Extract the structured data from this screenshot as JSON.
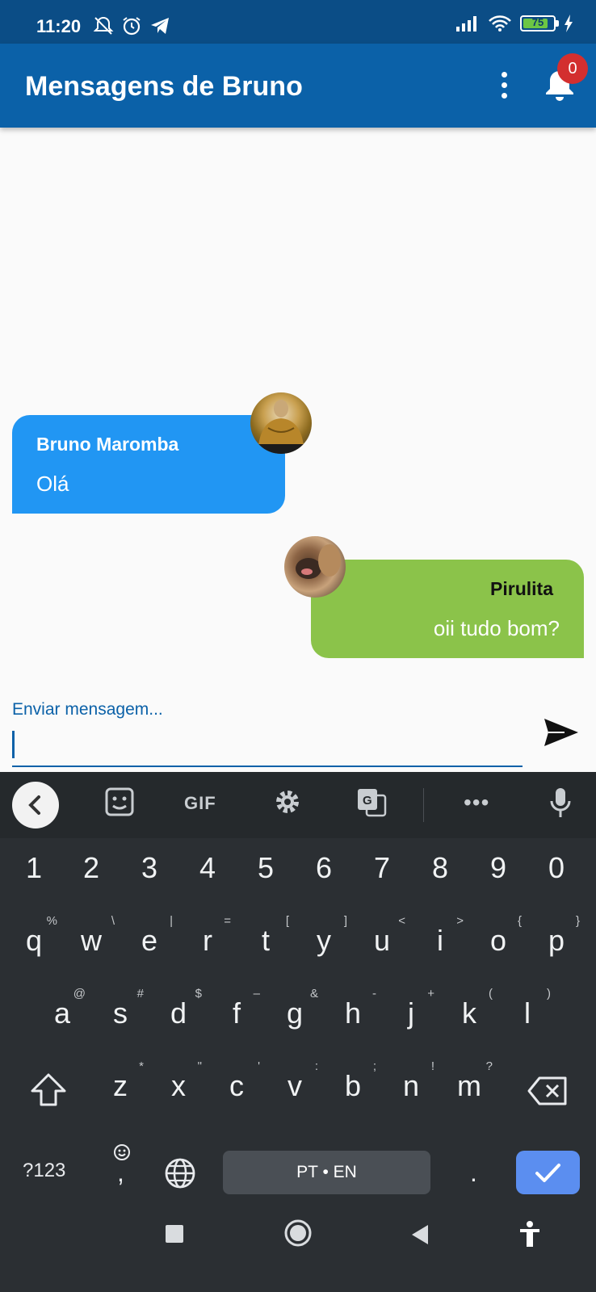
{
  "status_bar": {
    "time": "11:20",
    "battery": "75",
    "icons": [
      "bell-off-icon",
      "alarm-icon",
      "telegram-icon",
      "signal-icon",
      "wifi-icon",
      "battery-icon",
      "charging-icon"
    ]
  },
  "app_bar": {
    "title": "Mensagens de Bruno",
    "notification_count": "0"
  },
  "messages": [
    {
      "sender": "Bruno Maromba",
      "text": "Olá",
      "side": "left",
      "color": "#2196f3"
    },
    {
      "sender": "Pirulita",
      "text": "oii tudo bom?",
      "side": "right",
      "color": "#8bc34a"
    }
  ],
  "composer": {
    "label": "Enviar mensagem...",
    "value": ""
  },
  "keyboard": {
    "toolbar": {
      "gif": "GIF",
      "more": "•••"
    },
    "number_row": [
      "1",
      "2",
      "3",
      "4",
      "5",
      "6",
      "7",
      "8",
      "9",
      "0"
    ],
    "row1": {
      "keys": [
        "q",
        "w",
        "e",
        "r",
        "t",
        "y",
        "u",
        "i",
        "o",
        "p"
      ],
      "sup": [
        "%",
        "\\",
        "|",
        "=",
        "[",
        "]",
        "<",
        ">",
        "{",
        "}"
      ]
    },
    "row2": {
      "keys": [
        "a",
        "s",
        "d",
        "f",
        "g",
        "h",
        "j",
        "k",
        "l"
      ],
      "sup": [
        "@",
        "#",
        "$",
        "–",
        "&",
        "-",
        "+",
        "(",
        ")"
      ]
    },
    "row3": {
      "keys": [
        "z",
        "x",
        "c",
        "v",
        "b",
        "n",
        "m"
      ],
      "sup": [
        "*",
        "\"",
        "'",
        ":",
        ";",
        "!",
        "?"
      ]
    },
    "symbols_label": "?123",
    "comma": ",",
    "period": ".",
    "space_label": "PT • EN"
  },
  "theme": {
    "app_bar": "#0b61a8",
    "status_bar": "#0b4d86",
    "keyboard_bg": "#2b2f33",
    "enter_key": "#5b8ef0",
    "badge": "#d32f2f"
  }
}
